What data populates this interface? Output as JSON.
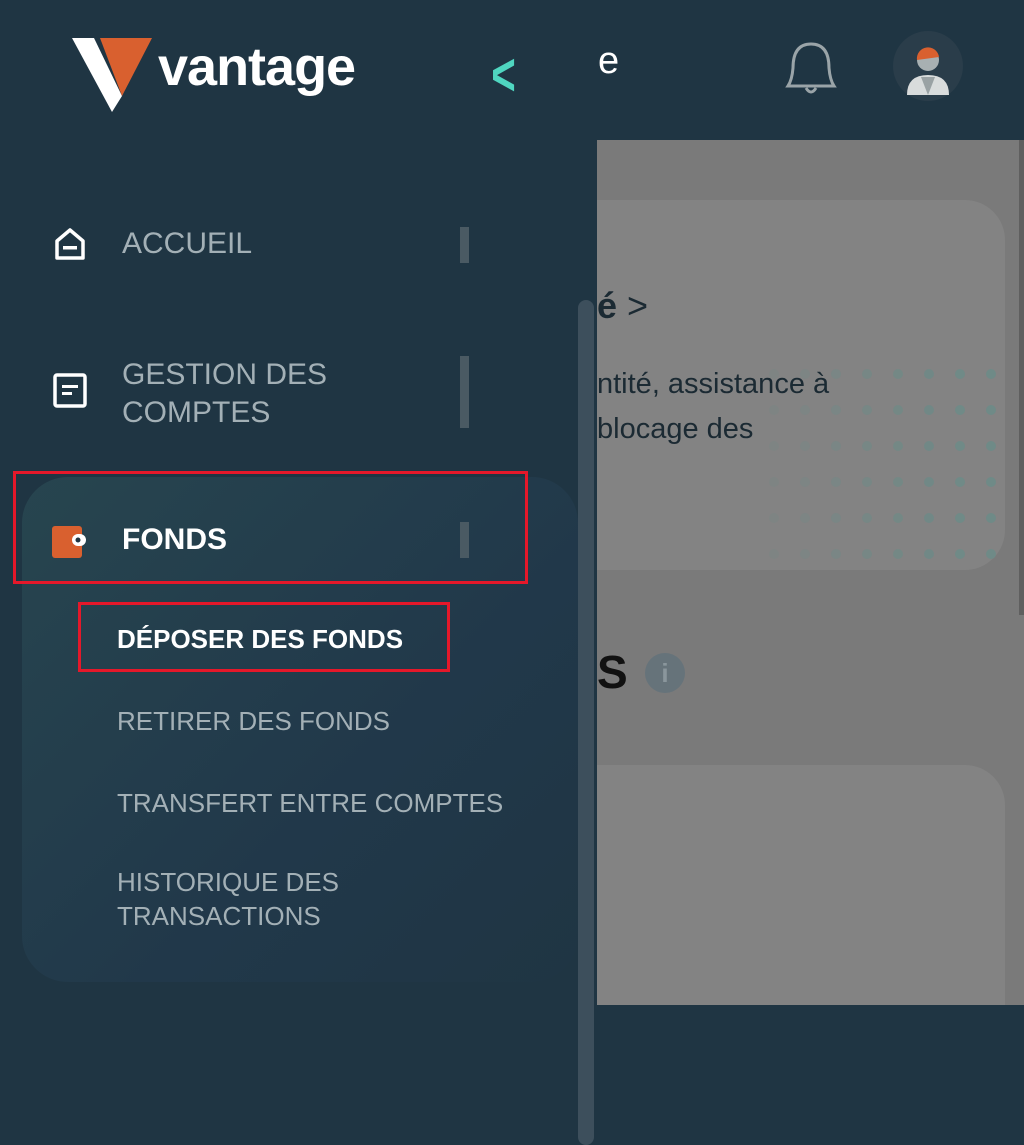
{
  "header": {
    "brand": "vantage",
    "back_icon": "chevron-left-icon",
    "title_fragment": "e",
    "notification_icon": "bell-icon",
    "avatar_icon": "user-avatar-icon"
  },
  "sidebar": {
    "items": [
      {
        "label": "ACCUEIL",
        "icon": "home-icon"
      },
      {
        "label": "GESTION DES COMPTES",
        "icon": "document-icon"
      },
      {
        "label": "FONDS",
        "icon": "wallet-icon",
        "expanded": true,
        "sub_items": [
          {
            "label": "DÉPOSER DES FONDS",
            "active": true
          },
          {
            "label": "RETIRER DES FONDS"
          },
          {
            "label": "TRANSFERT ENTRE COMPTES"
          },
          {
            "label": "HISTORIQUE DES TRANSACTIONS"
          }
        ]
      }
    ]
  },
  "content": {
    "card_title_fragment": "é",
    "card_desc_fragment": "ntité, assistance à\nblocage des",
    "section_title_fragment": "s",
    "info_icon": "info-icon"
  },
  "colors": {
    "accent": "#4fd6c0",
    "brand_orange": "#d9602f",
    "highlight": "#e5182a",
    "sidebar_bg": "#1f3543"
  }
}
